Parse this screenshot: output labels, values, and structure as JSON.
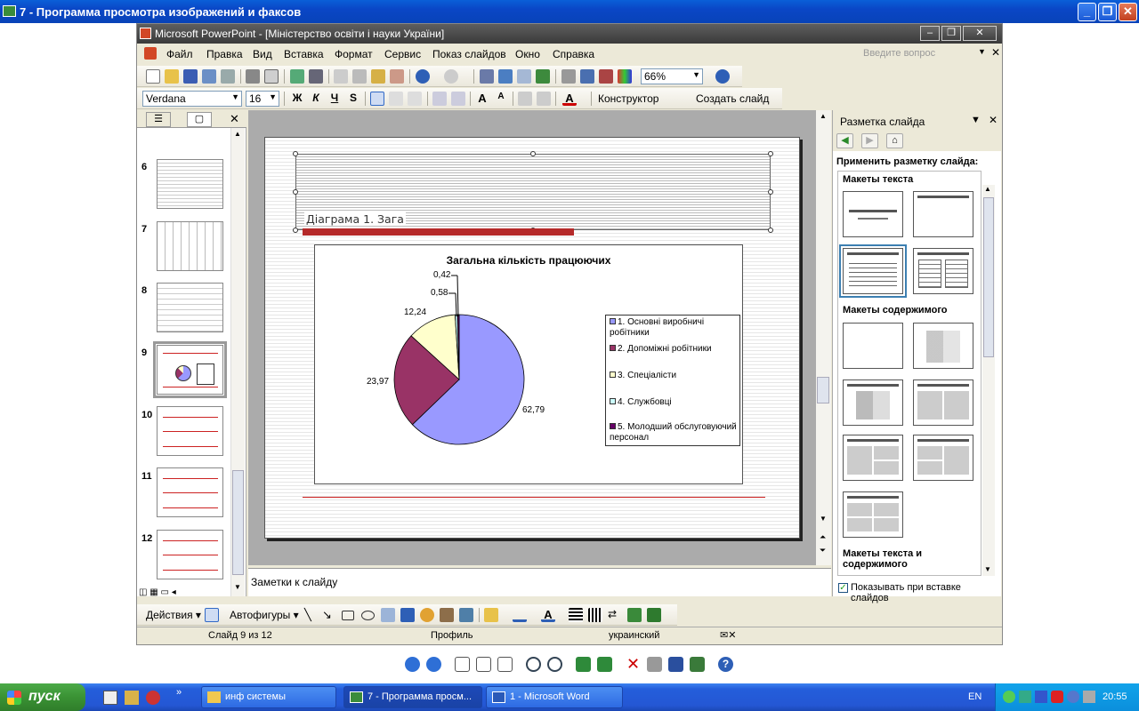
{
  "viewer": {
    "title": "7 - Программа просмотра изображений и факсов"
  },
  "ppt": {
    "title": "Microsoft PowerPoint - [Міністерство освіти і науки України]",
    "menu": [
      "Файл",
      "Правка",
      "Вид",
      "Вставка",
      "Формат",
      "Сервис",
      "Показ слайдов",
      "Окно",
      "Справка"
    ],
    "ask_placeholder": "Введите вопрос",
    "zoom": "66%",
    "font": "Verdana",
    "font_size": "16",
    "constructor": "Конструктор",
    "new_slide": "Создать слайд",
    "slides": [
      {
        "num": "6"
      },
      {
        "num": "7"
      },
      {
        "num": "8"
      },
      {
        "num": "9",
        "selected": true
      },
      {
        "num": "10"
      },
      {
        "num": "11"
      },
      {
        "num": "12"
      }
    ],
    "slide_title": "Діаграма 1. Зага",
    "notes_placeholder": "Заметки к слайду",
    "status": {
      "slide": "Слайд 9 из 12",
      "design": "Профиль",
      "language": "украинский"
    },
    "draw": {
      "actions": "Действия",
      "autoshapes": "Автофигуры"
    }
  },
  "taskpane": {
    "title": "Разметка слайда",
    "apply_label": "Применить разметку слайда:",
    "group_text": "Макеты текста",
    "group_content": "Макеты содержимого",
    "group_text_content": "Макеты текста и содержимого",
    "show_on_insert": "Показывать при вставке слайдов",
    "show_on_insert_checked": true
  },
  "chart_data": {
    "type": "pie",
    "title": "Загальна кількість працюючих",
    "categories": [
      "1. Основні виробничі робітники",
      "2. Допоміжні робітники",
      "3. Спеціалісти",
      "4. Службовці",
      "5. Молодший обслуговуючий персонал"
    ],
    "values": [
      62.79,
      23.97,
      12.24,
      0.58,
      0.42
    ],
    "labels": [
      "62,79",
      "23,97",
      "12,24",
      "0,58",
      "0,42"
    ],
    "colors": [
      "#9999ff",
      "#993366",
      "#ffffcc",
      "#ccffff",
      "#660066"
    ],
    "legend": "right"
  },
  "taskbar": {
    "start": "пуск",
    "items": [
      "инф системы",
      "7 - Программа просм...",
      "1 - Microsoft Word"
    ],
    "lang": "EN",
    "time": "20:55"
  }
}
